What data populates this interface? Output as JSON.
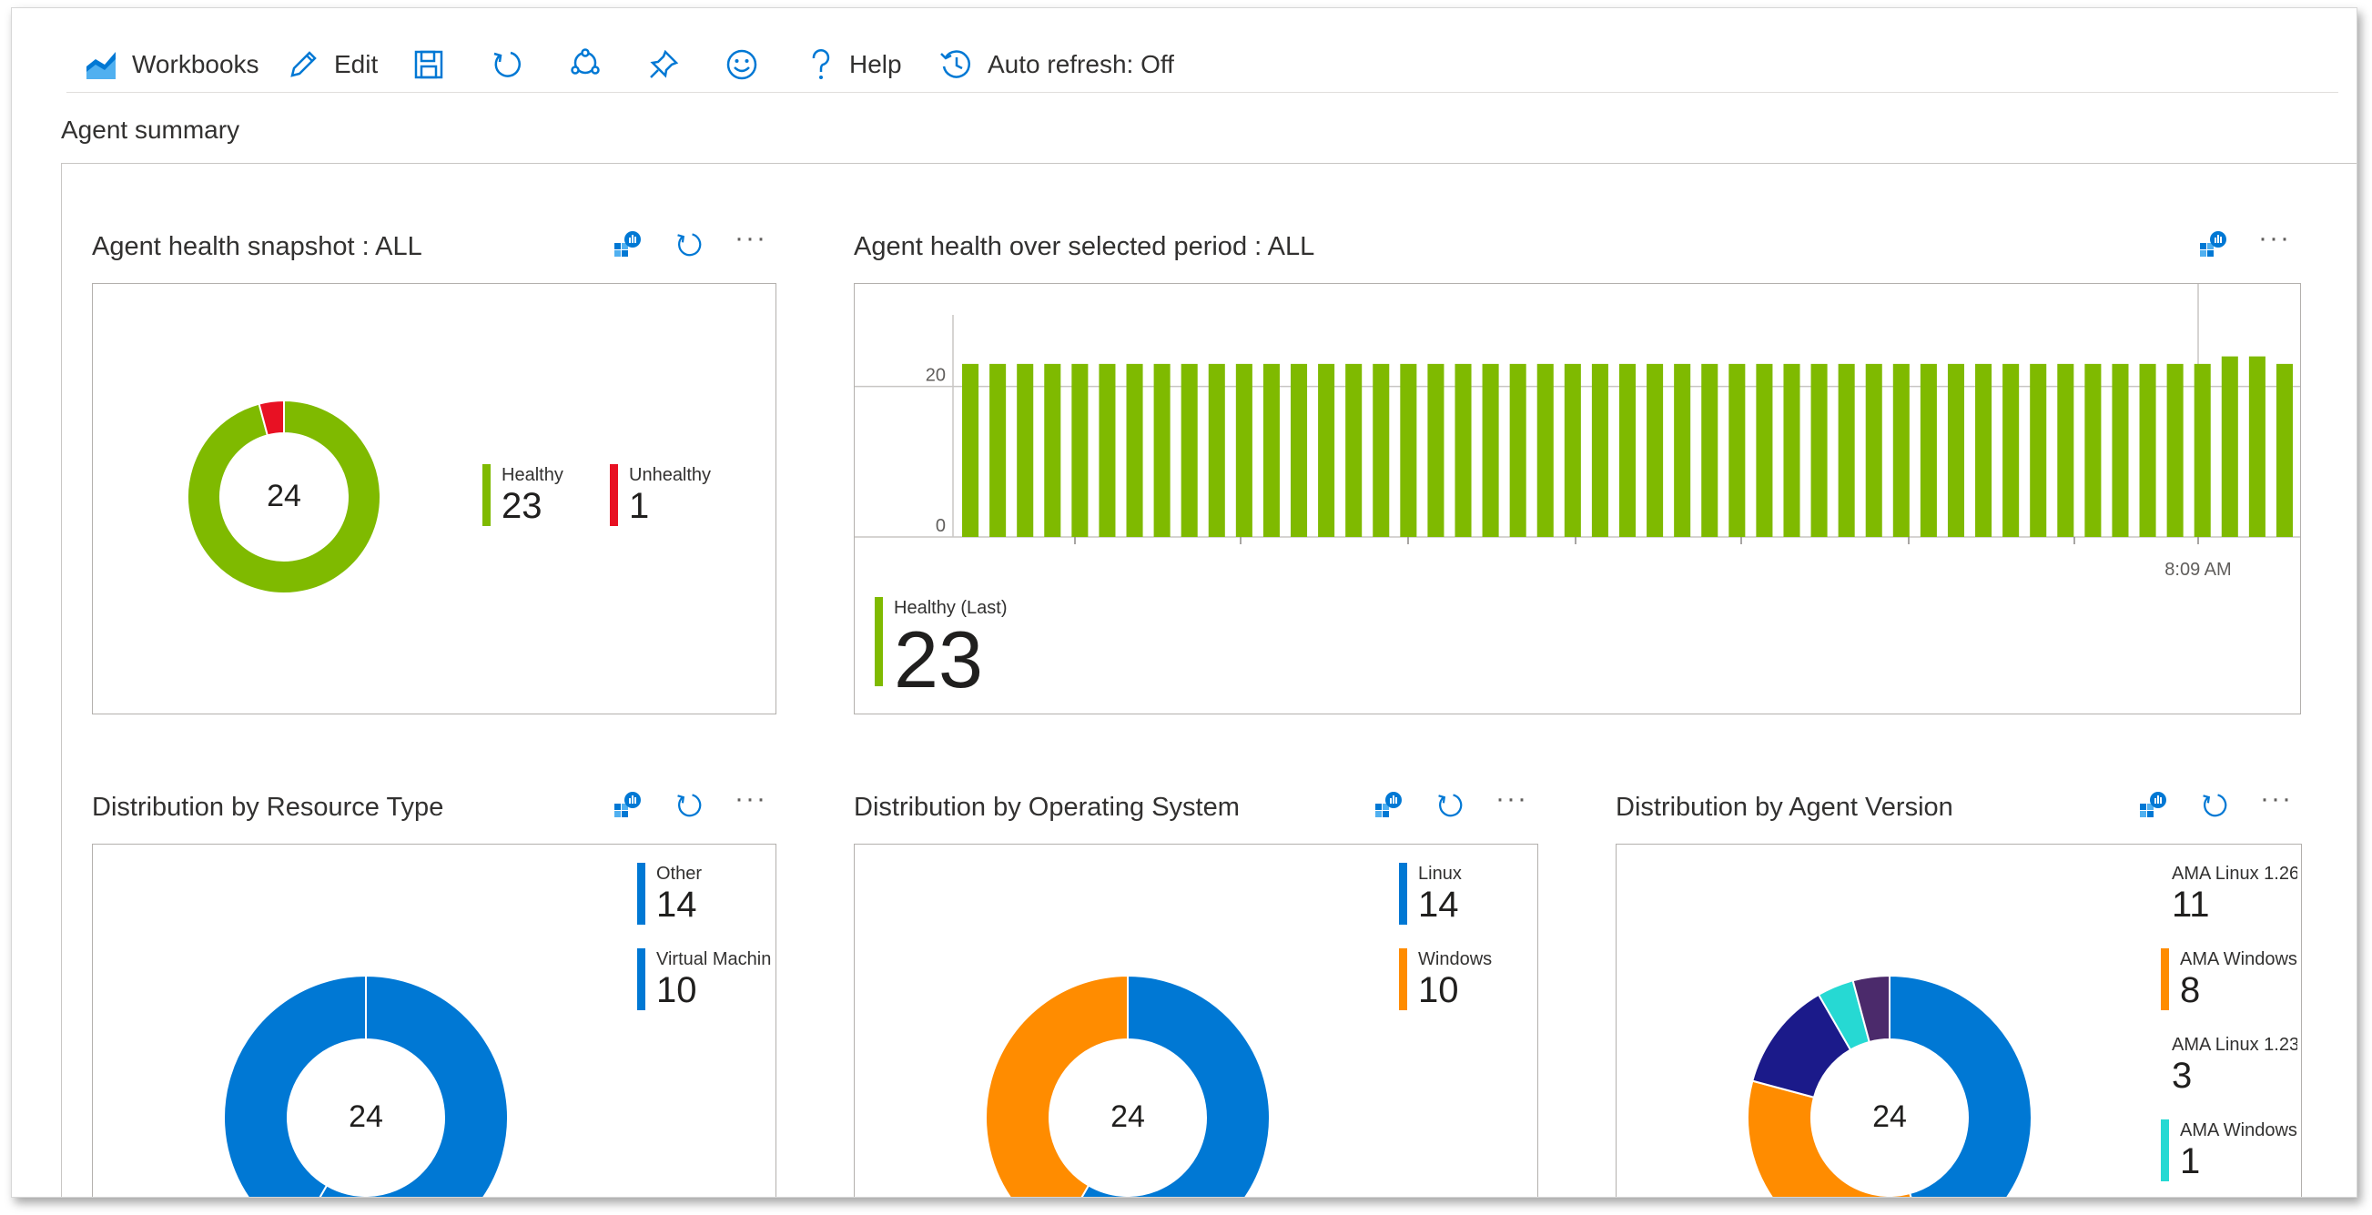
{
  "toolbar": {
    "workbooks_label": "Workbooks",
    "edit_label": "Edit",
    "help_label": "Help",
    "auto_refresh_label": "Auto refresh: Off"
  },
  "section_title": "Agent summary",
  "colors": {
    "healthy": "#7fba00",
    "unhealthy": "#e81123",
    "blue": "#0078d4",
    "orange": "#ff8c00",
    "navy": "#1b1a8a",
    "teal": "#26d9d3",
    "purple": "#4b2a6b",
    "toolbar_icon": "#0078d4"
  },
  "panels": {
    "snapshot": {
      "title": "Agent health snapshot : ALL",
      "center": "24",
      "legend": [
        {
          "label": "Healthy",
          "value": "23",
          "color": "#7fba00"
        },
        {
          "label": "Unhealthy",
          "value": "1",
          "color": "#e81123"
        }
      ]
    },
    "over_period": {
      "title": "Agent health over selected period : ALL",
      "legend_label": "Healthy (Last)",
      "legend_value": "23",
      "y_tick_0": "0",
      "y_tick_20": "20",
      "x_tick_label": "8:09 AM"
    },
    "resource_type": {
      "title": "Distribution by Resource Type",
      "center": "24",
      "legend": [
        {
          "label": "Other",
          "value": "14",
          "color": "#0078d4"
        },
        {
          "label": "Virtual Machin",
          "value": "10",
          "color": "#0078d4"
        }
      ]
    },
    "os": {
      "title": "Distribution by Operating System",
      "center": "24",
      "legend": [
        {
          "label": "Linux",
          "value": "14",
          "color": "#0078d4"
        },
        {
          "label": "Windows",
          "value": "10",
          "color": "#ff8c00"
        }
      ]
    },
    "agent_version": {
      "title": "Distribution by Agent Version",
      "center": "24",
      "legend": [
        {
          "label": "AMA Linux 1.26",
          "value": "11",
          "color": "#0078d4"
        },
        {
          "label": "AMA Windows",
          "value": "8",
          "color": "#ff8c00"
        },
        {
          "label": "AMA Linux 1.23",
          "value": "3",
          "color": "#1b1a8a"
        },
        {
          "label": "AMA Windows",
          "value": "1",
          "color": "#26d9d3"
        }
      ]
    }
  },
  "chart_data": [
    {
      "type": "pie",
      "title": "Agent health snapshot : ALL",
      "categories": [
        "Healthy",
        "Unhealthy"
      ],
      "values": [
        23,
        1
      ],
      "colors": [
        "#7fba00",
        "#e81123"
      ]
    },
    {
      "type": "bar",
      "title": "Agent health over selected period : ALL",
      "series": [
        {
          "name": "Healthy",
          "values": [
            23,
            23,
            23,
            23,
            23,
            23,
            23,
            23,
            23,
            23,
            23,
            23,
            23,
            23,
            23,
            23,
            23,
            23,
            23,
            23,
            23,
            23,
            23,
            23,
            23,
            23,
            23,
            23,
            23,
            23,
            23,
            23,
            23,
            23,
            23,
            23,
            23,
            23,
            23,
            23,
            23,
            23,
            23,
            23,
            23,
            23,
            24,
            24,
            23
          ]
        }
      ],
      "ylim": [
        0,
        30
      ],
      "yticks": [
        0,
        20
      ],
      "grid": true
    },
    {
      "type": "pie",
      "title": "Distribution by Resource Type",
      "categories": [
        "Other",
        "Virtual Machin"
      ],
      "values": [
        14,
        10
      ],
      "colors": [
        "#0078d4",
        "#0078d4"
      ]
    },
    {
      "type": "pie",
      "title": "Distribution by Operating System",
      "categories": [
        "Linux",
        "Windows"
      ],
      "values": [
        14,
        10
      ],
      "colors": [
        "#0078d4",
        "#ff8c00"
      ]
    },
    {
      "type": "pie",
      "title": "Distribution by Agent Version",
      "categories": [
        "AMA Linux 1.26",
        "AMA Windows",
        "AMA Linux 1.23",
        "AMA Windows",
        ""
      ],
      "values": [
        11,
        8,
        3,
        1,
        1
      ],
      "colors": [
        "#0078d4",
        "#ff8c00",
        "#1b1a8a",
        "#26d9d3",
        "#4b2a6b"
      ]
    }
  ]
}
